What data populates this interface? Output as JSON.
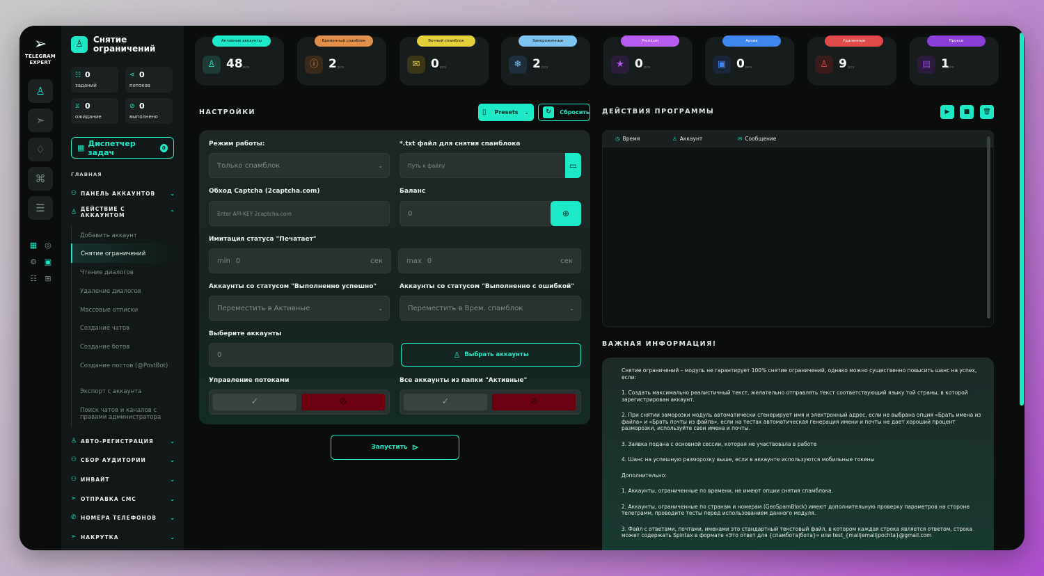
{
  "rail": {
    "brand_line1": "TELEGRAM",
    "brand_line2": "EXPERT"
  },
  "module": {
    "title_line1": "Снятие",
    "title_line2": "ограничений"
  },
  "stats": [
    {
      "value": "0",
      "label": "заданий",
      "icon": "list-icon"
    },
    {
      "value": "0",
      "label": "потоков",
      "icon": "share-icon"
    },
    {
      "value": "0",
      "label": "ожидание",
      "icon": "hourglass-icon"
    },
    {
      "value": "0",
      "label": "выполнено",
      "icon": "check-circle-icon"
    }
  ],
  "dispatcher": {
    "label": "Диспетчер задач",
    "count": "0"
  },
  "nav": {
    "section": "ГЛАВНАЯ",
    "accounts_panel": "ПАНЕЛЬ АККАУНТОВ",
    "account_actions": "ДЕЙСТВИЕ С АККАУНТОМ",
    "sub_items": [
      "Добавить аккаунт",
      "Снятие ограничений",
      "Чтение диалогов",
      "Удаление диалогов",
      "Массовые отписки",
      "Создание чатов",
      "Создание ботов",
      "Создание постов (@PostBot)",
      "Экспорт с аккаунта",
      "Поиск чатов и каналов с правами администратора"
    ],
    "auto_reg": "АВТО-РЕГИСТРАЦИЯ",
    "audience": "СБОР АУДИТОРИИ",
    "invite": "ИНВАЙТ",
    "sms": "ОТПРАВКА СМС",
    "phones": "НОМЕРА ТЕЛЕФОНОВ",
    "boost": "НАКРУТКА"
  },
  "counters": [
    {
      "label": "Активные аккаунты",
      "value": "48",
      "unit": "pcs",
      "color": "#1de9c6",
      "icon": "user-check-icon"
    },
    {
      "label": "Временный спамблок",
      "value": "2",
      "unit": "pcs",
      "color": "#e0904a",
      "icon": "alert-icon"
    },
    {
      "label": "Вечный спамблок",
      "value": "0",
      "unit": "pcs",
      "color": "#e2d13c",
      "icon": "mail-block-icon"
    },
    {
      "label": "Замороженные",
      "value": "2",
      "unit": "pcs",
      "color": "#7ec4f0",
      "icon": "snowflake-icon"
    },
    {
      "label": "Premium",
      "value": "0",
      "unit": "pcs",
      "color": "#b65cf0",
      "icon": "star-icon"
    },
    {
      "label": "Архив",
      "value": "0",
      "unit": "pcs",
      "color": "#3f86f0",
      "icon": "archive-user-icon"
    },
    {
      "label": "Удаленные",
      "value": "9",
      "unit": "pcs",
      "color": "#e04a4a",
      "icon": "user-x-icon"
    },
    {
      "label": "Прокси",
      "value": "1",
      "unit": "pcs",
      "color": "#8a3ed8",
      "icon": "proxy-icon"
    }
  ],
  "settings": {
    "title": "НАСТРОЙКИ",
    "presets": "Presets",
    "reset": "Сбросить",
    "mode_label": "Режим работы:",
    "mode_value": "Только спамблок",
    "txt_label": "*.txt файл для снятия спамблока",
    "txt_placeholder": "Путь к файлу",
    "captcha_label": "Обход Captcha (2captcha.com)",
    "captcha_placeholder": "Enter API-KEY 2captcha.com",
    "balance_label": "Баланс",
    "balance_value": "0",
    "typing_label": "Имитация статуса \"Печатает\"",
    "min_label": "min",
    "min_value": "0",
    "max_label": "max",
    "max_value": "0",
    "sec": "сек",
    "success_label": "Аккаунты со статусом \"Выполненно успешно\"",
    "success_value": "Переместить в Активные",
    "error_label": "Аккаунты со статусом \"Выполненно с ошибкой\"",
    "error_value": "Переместить в Врем. спамблок",
    "select_label": "Выберите аккаунты",
    "select_value": "0",
    "select_button": "Выбрать аккаунты",
    "threads_label": "Управление потоками",
    "all_active_label": "Все аккаунты из папки \"Активные\"",
    "start": "Запустить"
  },
  "actions": {
    "title": "ДЕЙСТВИЯ ПРОГРАММЫ",
    "col_time": "Время",
    "col_account": "Аккаунт",
    "col_message": "Сообщение"
  },
  "info": {
    "title": "ВАЖНАЯ ИНФОРМАЦИЯ!",
    "paragraphs": [
      "Снятие ограничений – модуль не гарантирует 100% снятие ограничений, однако можно существенно повысить шанс на успех, если:",
      "1. Создать максимально реалистичный текст, желательно отправлять текст соответствующий языку той страны, в которой зарегистрирован аккаунт.",
      "2. При снятии заморозки модуль автоматически сгенерирует имя и электронный адрес, если не выбрана опция «Брать имена из файла» и «Брать почты из файла», если на тестах автоматическая генерация имени и почты не дает хороший процент разморозки, используйте свои имена и почты.",
      "3. Заявка подана с основной сессии, которая не участвовала в работе",
      "4. Шанс на успешную разморозку выше, если в аккаунте используются мобильные токены",
      "Дополнительно:",
      "1. Аккаунты, ограниченные по времени, не имеют опции снятия спамблока.",
      "2. Аккаунты, ограниченные по странам и номерам (GeoSpamBlock) имеют дополнительную проверку параметров на стороне телеграмм, проводите тесты перед использованием данного модуля.",
      "3. Файл с ответами, почтами, именами это стандартный текстовый файл, в котором каждая строка является ответом, строка может содержать Spintax в формате «Это ответ для {спамбота|бота}» или test_{mail|email|pochta}@gmail.com"
    ]
  }
}
